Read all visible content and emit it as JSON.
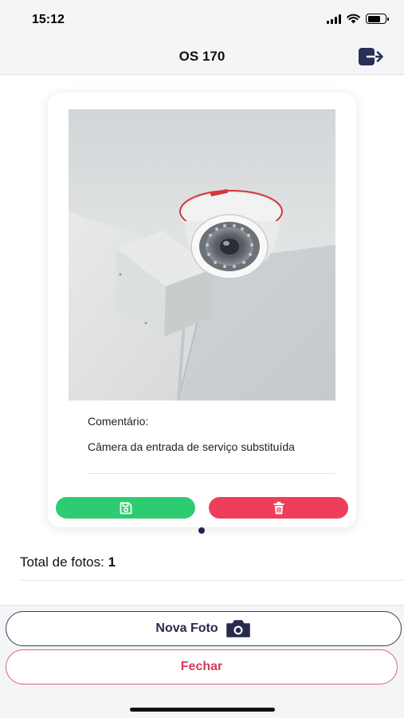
{
  "status_bar": {
    "time": "15:12",
    "icons": [
      "signal-icon",
      "wifi-icon",
      "battery-icon"
    ]
  },
  "header": {
    "title": "OS 170",
    "logout_icon": "logout-icon",
    "accent_color": "#2a2f5a"
  },
  "photo_card": {
    "photo": "photo of a dome security camera mounted in a ceiling corner next to a white junction box",
    "comment_label": "Comentário:",
    "comment_text": "Câmera da entrada de serviço substituída",
    "save_button_icon": "save-icon",
    "delete_button_icon": "trash-icon",
    "save_color": "#2ecc71",
    "delete_color": "#ee3e5a"
  },
  "pager": {
    "current_page": 1,
    "total_pages": 1
  },
  "summary": {
    "total_label": "Total de fotos:",
    "total_value": "1"
  },
  "footer": {
    "new_photo_label": "Nova Foto",
    "new_photo_icon": "camera-icon",
    "close_label": "Fechar",
    "close_color": "#d83a5d"
  }
}
